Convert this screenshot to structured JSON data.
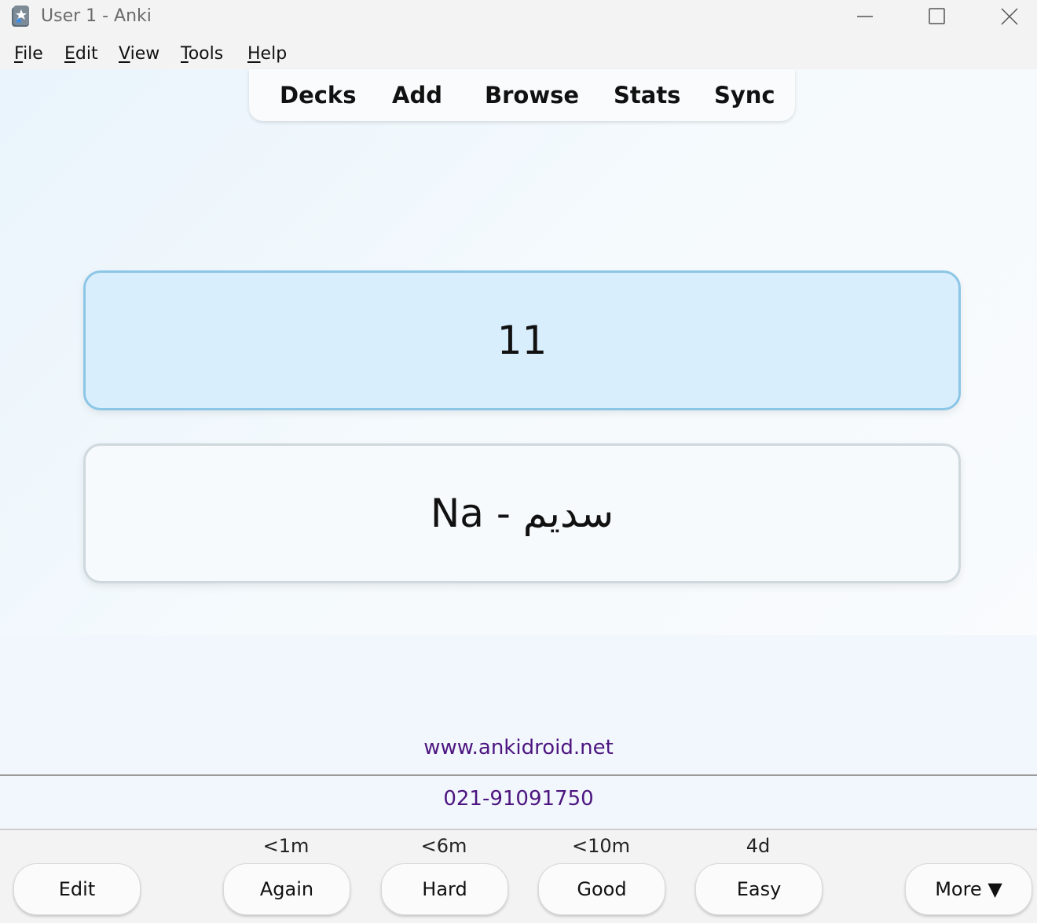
{
  "window": {
    "title": "User 1 - Anki"
  },
  "menu": {
    "items": [
      {
        "label": "File",
        "accel": "F",
        "rest": "ile"
      },
      {
        "label": "Edit",
        "accel": "E",
        "rest": "dit"
      },
      {
        "label": "View",
        "accel": "V",
        "rest": "iew"
      },
      {
        "label": "Tools",
        "accel": "T",
        "rest": "ools"
      },
      {
        "label": "Help",
        "accel": "H",
        "rest": "elp"
      }
    ]
  },
  "toolbar": {
    "items": [
      "Decks",
      "Add",
      "Browse",
      "Stats",
      "Sync"
    ]
  },
  "card": {
    "front": "11",
    "back": "Na - سدیم"
  },
  "footer": {
    "website": "www.ankidroid.net",
    "phone": "021-91091750",
    "link_color": "#4d1580"
  },
  "bottom": {
    "edit_label": "Edit",
    "more_label": "More ▼",
    "answers": [
      {
        "label": "Again",
        "interval": "<1m"
      },
      {
        "label": "Hard",
        "interval": "<6m"
      },
      {
        "label": "Good",
        "interval": "<10m"
      },
      {
        "label": "Easy",
        "interval": "4d"
      }
    ]
  },
  "colors": {
    "front_card_bg": "#d9eefd",
    "front_card_border": "#8cc6e6"
  }
}
